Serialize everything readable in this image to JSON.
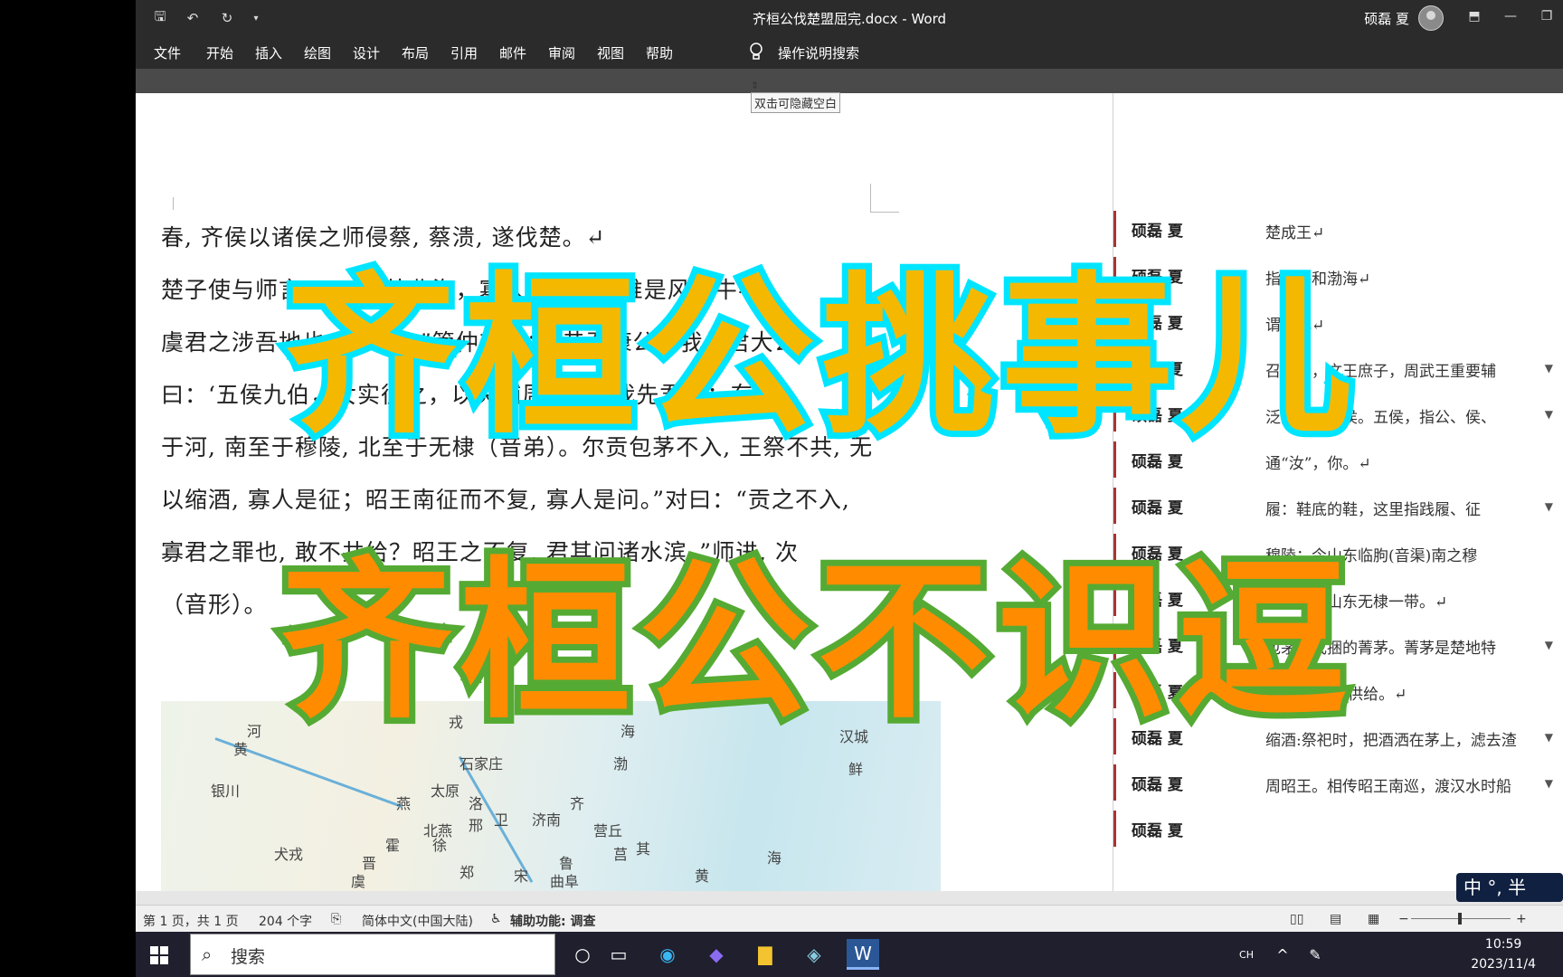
{
  "window": {
    "doc_title": "齐桓公伐楚盟屈完.docx  -  Word",
    "user": "硕磊 夏"
  },
  "ribbon": {
    "tabs": [
      "文件",
      "开始",
      "插入",
      "绘图",
      "设计",
      "布局",
      "引用",
      "邮件",
      "审阅",
      "视图",
      "帮助"
    ],
    "search_hint": "操作说明搜索"
  },
  "tooltip": "双击可隐藏空白",
  "document": {
    "lines": [
      "春, 齐侯以诸侯之师侵蔡, 蔡溃, 遂伐楚。↵",
      "楚子使与师言曰：“君处北海，寡人处南海，唯是风马牛不",
      "虞君之涉吾地也，何故？”管仲对曰：“昔召康公命我先君大公",
      "曰：‘五侯九伯，女实征之，以夹辅周室。’赐我先君履：东至",
      "于河, 南至于穆陵, 北至于无棣（音弟）。尔贡包茅不入, 王祭不共, 无",
      "以缩酒, 寡人是征；昭王南征而不复, 寡人是问。”对曰：“贡之不入,",
      "寡君之罪也, 敢不共给？昭王之不复, 君其问诸水滨。”师进, 次",
      "（音形）。"
    ],
    "map_labels": [
      "黄",
      "河",
      "银川",
      "燕",
      "戎",
      "太原",
      "石家庄",
      "北燕",
      "洛",
      "邢",
      "卫",
      "济南",
      "齐",
      "营丘",
      "鲁",
      "曲阜",
      "宋",
      "黄",
      "海",
      "汉城",
      "鲜",
      "晋",
      "霍",
      "虞",
      "徐",
      "郑",
      "莒",
      "其",
      "犬戎",
      "渤",
      "海"
    ]
  },
  "comments": [
    {
      "author": "硕磊 夏",
      "text": "楚成王↵"
    },
    {
      "author": "硕磊 夏",
      "text": "指渤海和渤海↵"
    },
    {
      "author": "硕磊 夏",
      "text": "谓风化↵"
    },
    {
      "author": "硕磊 夏",
      "text": "召康公，文王庶子，周武王重要辅"
    },
    {
      "author": "硕磊 夏",
      "text": "泛指天下诸侯。五侯，指公、侯、"
    },
    {
      "author": "硕磊 夏",
      "text": "通“汝”，你。↵"
    },
    {
      "author": "硕磊 夏",
      "text": "履：鞋底的鞋，这里指践履、征"
    },
    {
      "author": "硕磊 夏",
      "text": "穆陵：今山东临朐(音渠)南之穆"
    },
    {
      "author": "硕磊 夏",
      "text": "无棣：今山东无棣一带。↵"
    },
    {
      "author": "硕磊 夏",
      "text": "包茅：成捆的菁茅。菁茅是楚地特"
    },
    {
      "author": "硕磊 夏",
      "text": "共:通“供”，供给。↵"
    },
    {
      "author": "硕磊 夏",
      "text": "缩酒:祭祀时，把酒洒在茅上，滤去渣"
    },
    {
      "author": "硕磊 夏",
      "text": "周昭王。相传昭王南巡，渡汉水时船"
    },
    {
      "author": "硕磊 夏",
      "text": ""
    }
  ],
  "overlay": {
    "title1": "齐桓公挑事儿",
    "title2": "齐桓公不识逗"
  },
  "status": {
    "page": "第 1 页，共 1 页",
    "words": "204 个字",
    "lang": "简体中文(中国大陆)",
    "access": "辅助功能: 调查"
  },
  "taskbar": {
    "search": "搜索",
    "ime_lang": "CH",
    "time": "10:59",
    "date": "2023/11/4",
    "ime": "中 °, 半"
  }
}
